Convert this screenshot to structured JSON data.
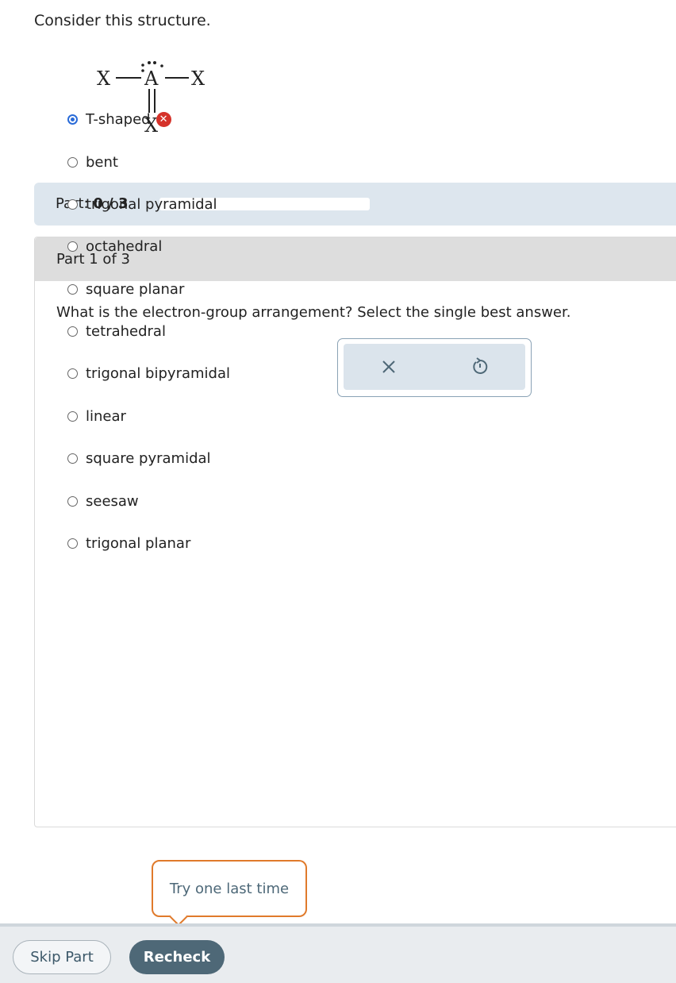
{
  "prompt": "Consider this structure.",
  "structure": {
    "left_atom": "X",
    "center_atom": "A",
    "right_atom": "X",
    "bottom_atom": "X"
  },
  "part_progress": {
    "label": "Part:",
    "value": "0 / 3",
    "fraction": 0
  },
  "panel": {
    "heading": "Part 1 of 3",
    "question": "What is the electron-group arrangement? Select the single best answer."
  },
  "options": [
    {
      "label": "T-shaped",
      "selected": true,
      "marked_wrong": true
    },
    {
      "label": "bent",
      "selected": false
    },
    {
      "label": "trigonal pyramidal",
      "selected": false
    },
    {
      "label": "octahedral",
      "selected": false
    },
    {
      "label": "square planar",
      "selected": false
    },
    {
      "label": "tetrahedral",
      "selected": false
    },
    {
      "label": "trigonal bipyramidal",
      "selected": false
    },
    {
      "label": "linear",
      "selected": false
    },
    {
      "label": "square pyramidal",
      "selected": false
    },
    {
      "label": "seesaw",
      "selected": false
    },
    {
      "label": "trigonal planar",
      "selected": false
    }
  ],
  "tools": {
    "clear_icon": "close-icon",
    "reset_icon": "undo-icon"
  },
  "tooltip": "Try one last time",
  "footer": {
    "skip_label": "Skip Part",
    "recheck_label": "Recheck"
  },
  "colors": {
    "selected_radio": "#2a6bd8",
    "wrong_marker": "#d5322a",
    "tooltip_border": "#e07a2b",
    "primary_button": "#4e6877"
  }
}
